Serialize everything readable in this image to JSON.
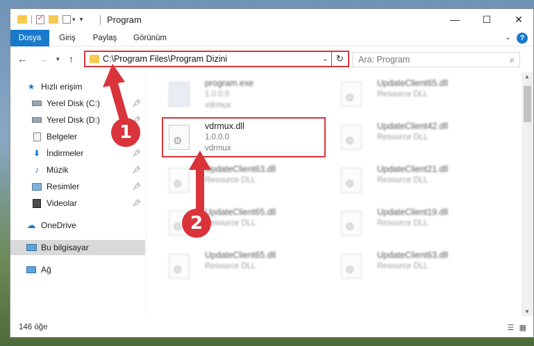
{
  "window": {
    "title": "Program",
    "controls": {
      "minimize": "—",
      "maximize": "☐",
      "close": "✕"
    }
  },
  "ribbon": {
    "tabs": [
      {
        "label": "Dosya",
        "active": true
      },
      {
        "label": "Giriş",
        "active": false
      },
      {
        "label": "Paylaş",
        "active": false
      },
      {
        "label": "Görünüm",
        "active": false
      }
    ],
    "help": "?"
  },
  "address": {
    "path": "C:\\Program Files\\Program Dizini"
  },
  "search": {
    "placeholder": "Ara: Program"
  },
  "nav": {
    "items": [
      {
        "label": "Hızlı erişim",
        "icon": "star-icon"
      },
      {
        "label": "Yerel Disk (C:)",
        "icon": "drive-icon"
      },
      {
        "label": "Yerel Disk (D:)",
        "icon": "drive-icon"
      },
      {
        "label": "Belgeler",
        "icon": "documents-icon"
      },
      {
        "label": "İndirmeler",
        "icon": "download-icon"
      },
      {
        "label": "Müzik",
        "icon": "music-icon"
      },
      {
        "label": "Resimler",
        "icon": "pictures-icon"
      },
      {
        "label": "Videolar",
        "icon": "video-icon"
      },
      {
        "label": "OneDrive",
        "icon": "cloud-icon"
      },
      {
        "label": "Bu bilgisayar",
        "icon": "computer-icon"
      },
      {
        "label": "Ağ",
        "icon": "network-icon"
      }
    ]
  },
  "files": [
    {
      "name": "program.exe",
      "line2": "1.0.0.0",
      "line3": "vdrmux"
    },
    {
      "name": "UpdateClient65.dll",
      "line2": "Resource DLL",
      "line3": ""
    },
    {
      "name": "vdrmux.dll",
      "line2": "1.0.0.0",
      "line3": "vdrmux"
    },
    {
      "name": "UpdateClient42.dll",
      "line2": "Resource DLL",
      "line3": ""
    },
    {
      "name": "UpdateClient63.dll",
      "line2": "Resource DLL",
      "line3": ""
    },
    {
      "name": "UpdateClient21.dll",
      "line2": "Resource DLL",
      "line3": ""
    },
    {
      "name": "UpdateClient65.dll",
      "line2": "Resource DLL",
      "line3": ""
    },
    {
      "name": "UpdateClient19.dll",
      "line2": "Resource DLL",
      "line3": ""
    },
    {
      "name": "UpdateClient65.dll",
      "line2": "Resource DLL",
      "line3": ""
    },
    {
      "name": "UpdateClient63.dll",
      "line2": "Resource DLL",
      "line3": ""
    }
  ],
  "status": {
    "count": "146 öğe"
  },
  "callouts": {
    "one": "1",
    "two": "2"
  },
  "colors": {
    "accent": "#1979ca",
    "highlight": "#d9343b"
  }
}
